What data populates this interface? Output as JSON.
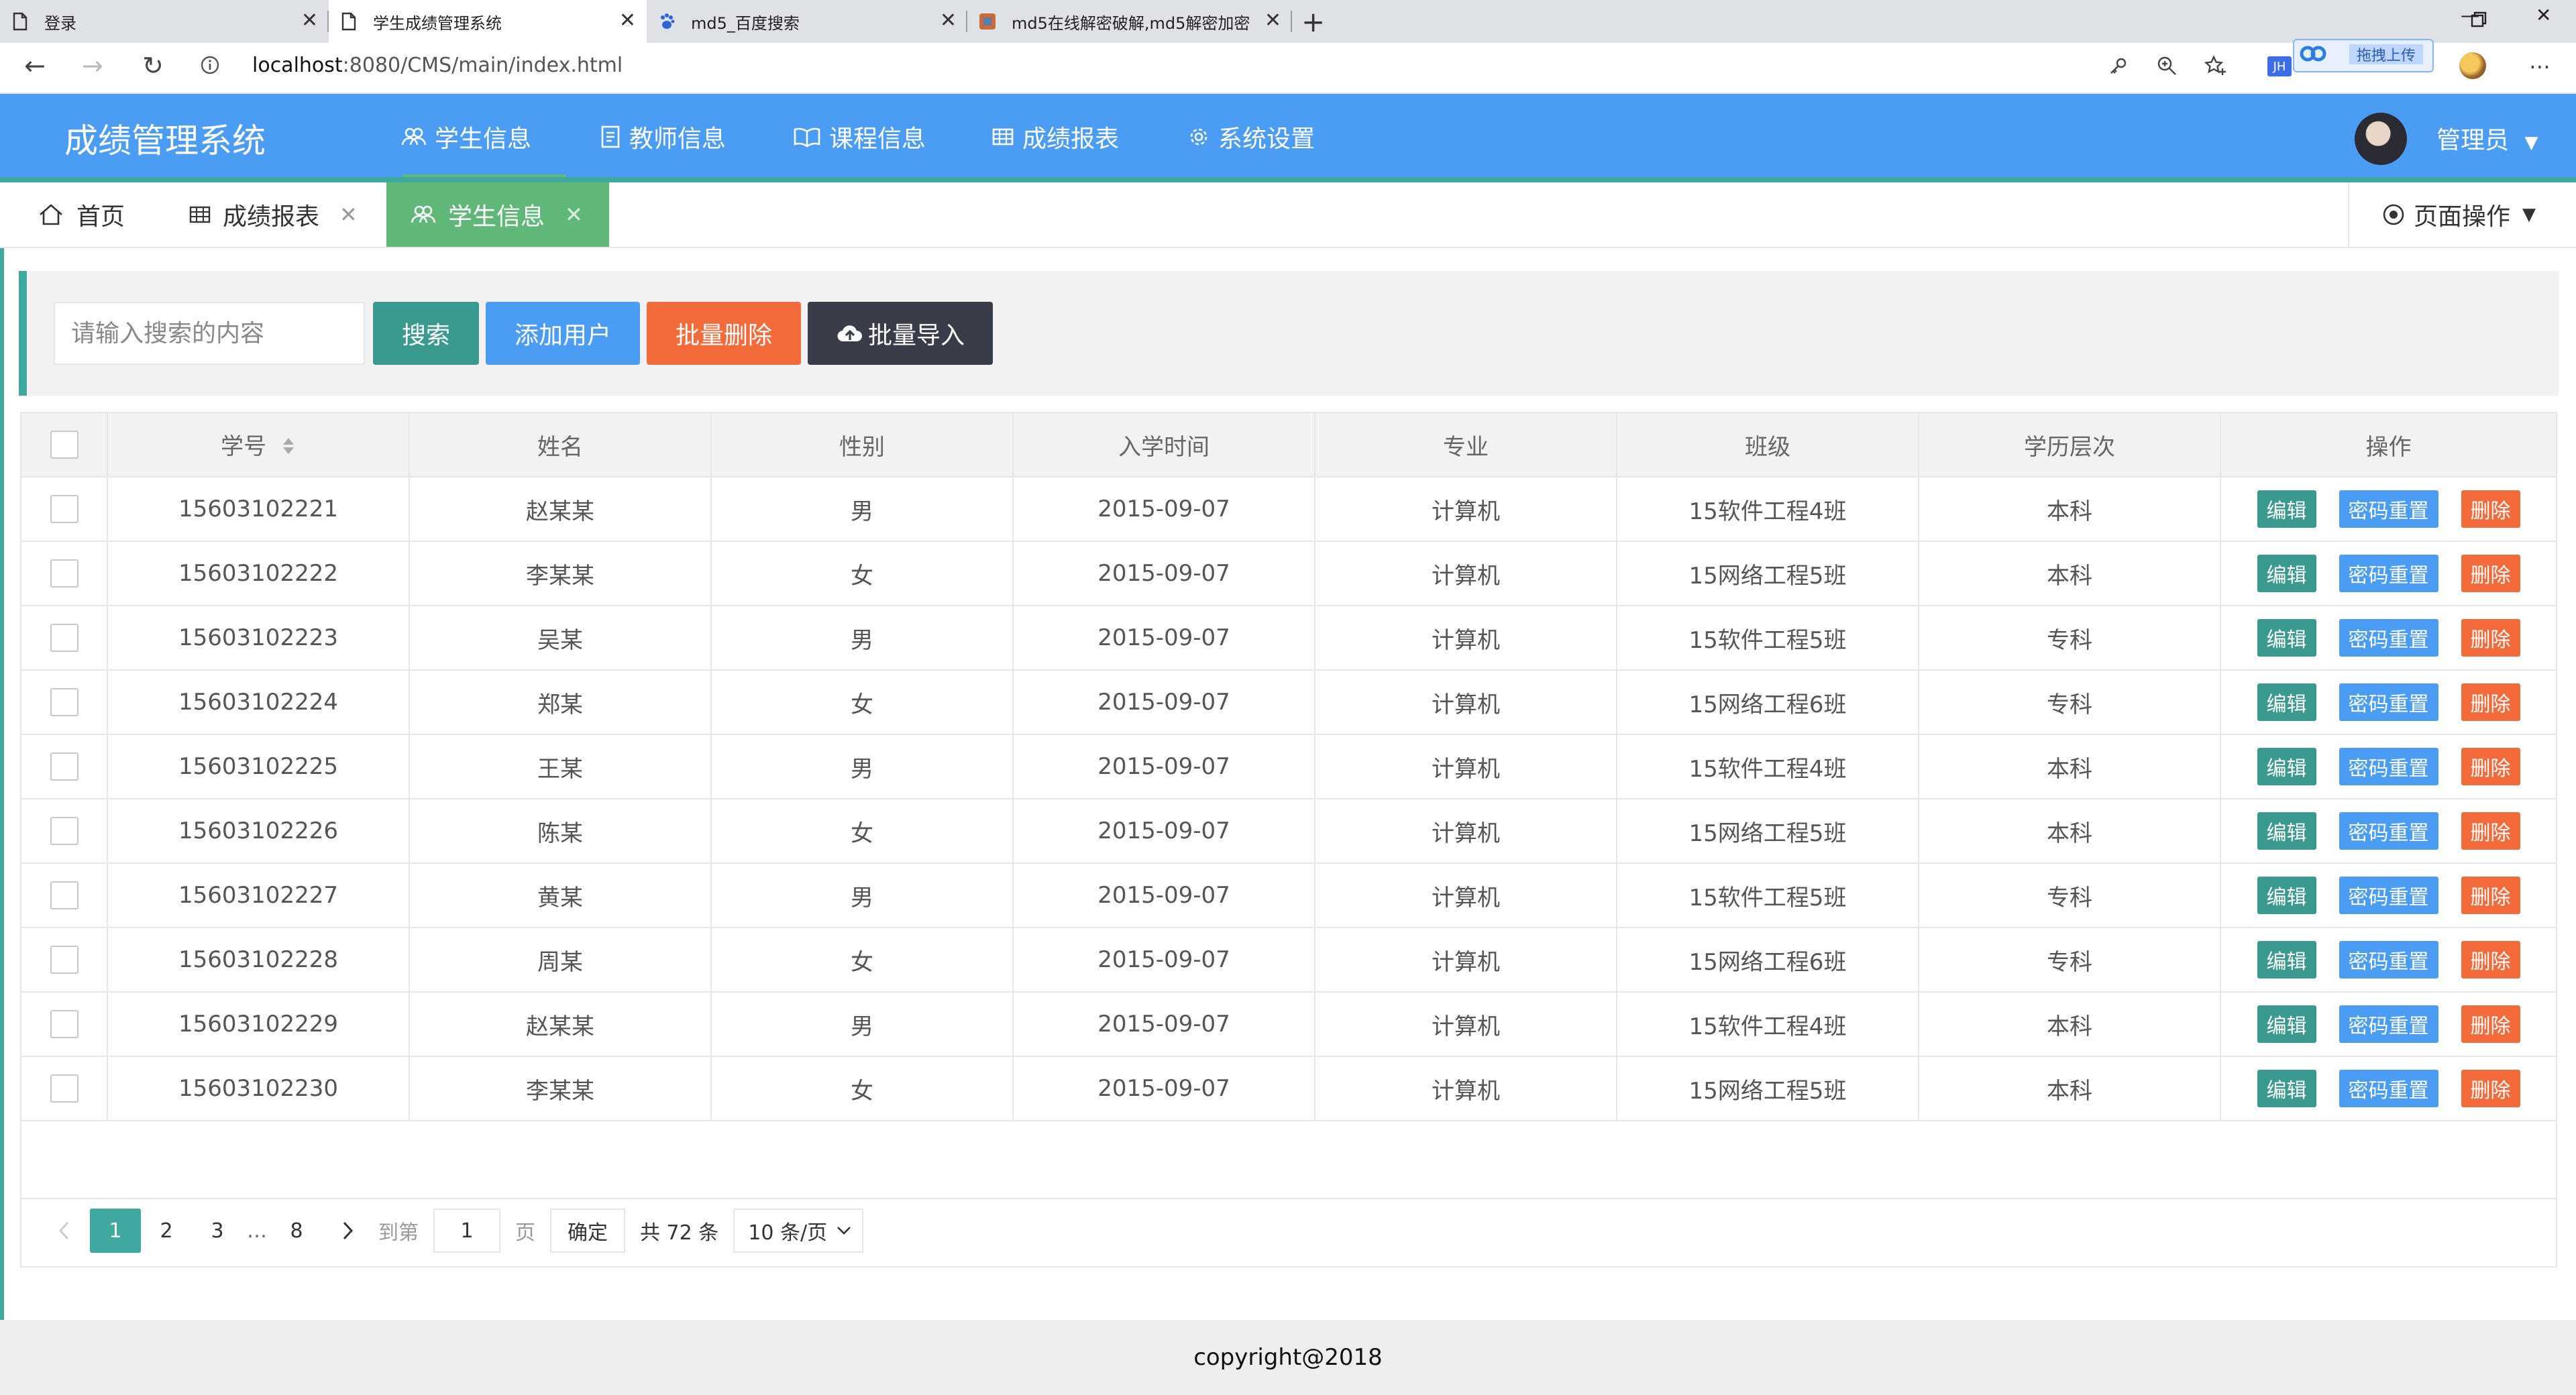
{
  "browser": {
    "tabs": [
      {
        "title": "登录"
      },
      {
        "title": "学生成绩管理系统"
      },
      {
        "title": "md5_百度搜索"
      },
      {
        "title": "md5在线解密破解,md5解密加密"
      }
    ],
    "new_tab": "+",
    "url_host": "localhost",
    "url_path": ":8080/CMS/main/index.html",
    "extension_label": "拖拽上传",
    "extension_badge": "JH"
  },
  "app": {
    "title": "成绩管理系统",
    "nav": [
      "学生信息",
      "教师信息",
      "课程信息",
      "成绩报表",
      "系统设置"
    ],
    "user": "管理员",
    "colors": {
      "header": "#4b9df3",
      "accent": "#3fa9a0",
      "active_tab": "#5fb878"
    }
  },
  "page_tabs": {
    "items": [
      {
        "label": "首页"
      },
      {
        "label": "成绩报表"
      },
      {
        "label": "学生信息"
      }
    ],
    "close": "✕",
    "page_ops": "页面操作"
  },
  "toolbar": {
    "search_placeholder": "请输入搜索的内容",
    "search": "搜索",
    "add_user": "添加用户",
    "batch_delete": "批量删除",
    "batch_import": "批量导入"
  },
  "table": {
    "headers": [
      "学号",
      "姓名",
      "性别",
      "入学时间",
      "专业",
      "班级",
      "学历层次",
      "操作"
    ],
    "rows": [
      [
        "15603102221",
        "赵某某",
        "男",
        "2015-09-07",
        "计算机",
        "15软件工程4班",
        "本科"
      ],
      [
        "15603102222",
        "李某某",
        "女",
        "2015-09-07",
        "计算机",
        "15网络工程5班",
        "本科"
      ],
      [
        "15603102223",
        "吴某",
        "男",
        "2015-09-07",
        "计算机",
        "15软件工程5班",
        "专科"
      ],
      [
        "15603102224",
        "郑某",
        "女",
        "2015-09-07",
        "计算机",
        "15网络工程6班",
        "专科"
      ],
      [
        "15603102225",
        "王某",
        "男",
        "2015-09-07",
        "计算机",
        "15软件工程4班",
        "本科"
      ],
      [
        "15603102226",
        "陈某",
        "女",
        "2015-09-07",
        "计算机",
        "15网络工程5班",
        "本科"
      ],
      [
        "15603102227",
        "黄某",
        "男",
        "2015-09-07",
        "计算机",
        "15软件工程5班",
        "专科"
      ],
      [
        "15603102228",
        "周某",
        "女",
        "2015-09-07",
        "计算机",
        "15网络工程6班",
        "专科"
      ],
      [
        "15603102229",
        "赵某某",
        "男",
        "2015-09-07",
        "计算机",
        "15软件工程4班",
        "本科"
      ],
      [
        "15603102230",
        "李某某",
        "女",
        "2015-09-07",
        "计算机",
        "15网络工程5班",
        "本科"
      ]
    ],
    "ops": {
      "edit": "编辑",
      "reset_password": "密码重置",
      "delete": "删除"
    }
  },
  "pager": {
    "pages": [
      "1",
      "2",
      "3"
    ],
    "ellipsis": "…",
    "last": "8",
    "goto_prefix": "到第",
    "goto_value": "1",
    "goto_suffix": "页",
    "confirm": "确定",
    "total": "共 72 条",
    "page_size": "10 条/页"
  },
  "footer": {
    "text": "copyright@2018"
  }
}
